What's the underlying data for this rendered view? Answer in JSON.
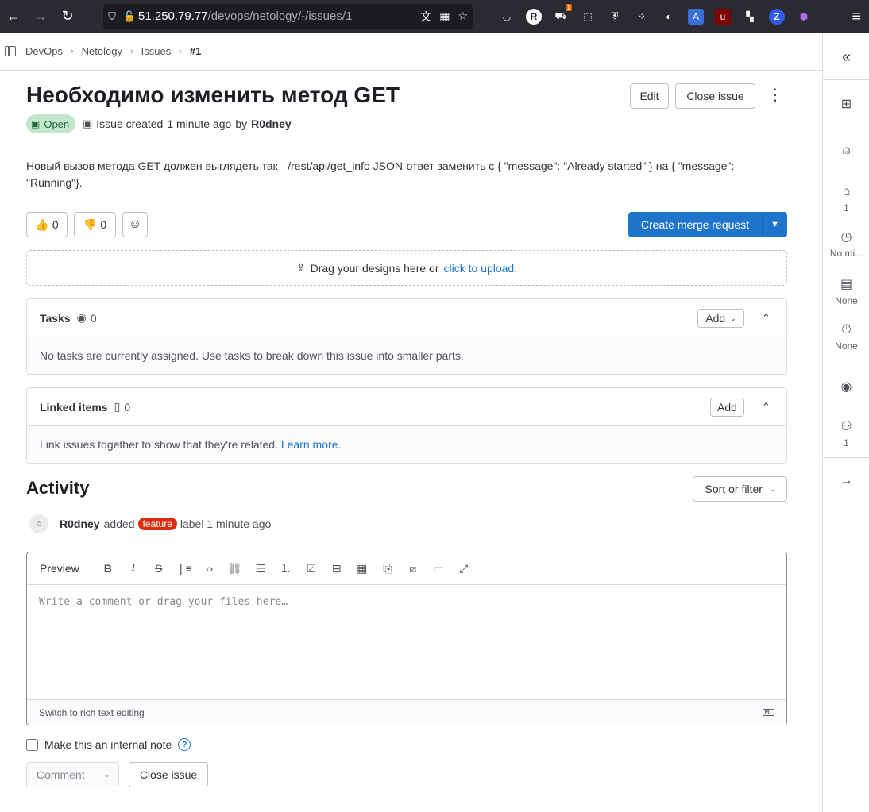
{
  "browser": {
    "url_host": "51.250.79.77",
    "url_path": "/devops/netology/-/issues/1",
    "ext_badge": "1"
  },
  "breadcrumb": [
    "DevOps",
    "Netology",
    "Issues",
    "#1"
  ],
  "issue": {
    "title": "Необходимо изменить метод GET",
    "status": "Open",
    "meta_prefix": "Issue created",
    "meta_time": "1 minute ago",
    "meta_by": "by",
    "author": "R0dney",
    "description": "Новый вызов метода GET должен выглядеть так - /rest/api/get_info JSON-ответ заменить с { \"message\": \"Already started\" } на { \"message\": \"Running\"}.",
    "edit_label": "Edit",
    "close_label": "Close issue",
    "thumbs_up": "0",
    "thumbs_down": "0",
    "create_mr_label": "Create merge request"
  },
  "designs": {
    "text": "Drag your designs here or",
    "link": "click to upload",
    "suffix": "."
  },
  "tasks": {
    "heading": "Tasks",
    "count": "0",
    "add_label": "Add",
    "empty_text": "No tasks are currently assigned. Use tasks to break down this issue into smaller parts."
  },
  "linked": {
    "heading": "Linked items",
    "count": "0",
    "add_label": "Add",
    "empty_text": "Link issues together to show that they're related.",
    "learn_more": "Learn more."
  },
  "activity": {
    "heading": "Activity",
    "sort_label": "Sort or filter",
    "event_user": "R0dney",
    "event_action": "added",
    "event_label": "feature",
    "event_suffix": "label 1 minute ago"
  },
  "editor": {
    "preview_label": "Preview",
    "placeholder": "Write a comment or drag your files here…",
    "switch_label": "Switch to rich text editing",
    "md_badge": "M↓"
  },
  "footer": {
    "internal_note_label": "Make this an internal note",
    "comment_label": "Comment",
    "close_label": "Close issue"
  },
  "sidebar": {
    "labels_count": "1",
    "milestone": "No mi...",
    "due_date": "None",
    "time_tracking": "None",
    "participants_count": "1"
  },
  "colors": {
    "primary": "#1f75cb",
    "open_badge_bg": "#c3e6cd",
    "label_feature": "#dd2b0e"
  }
}
